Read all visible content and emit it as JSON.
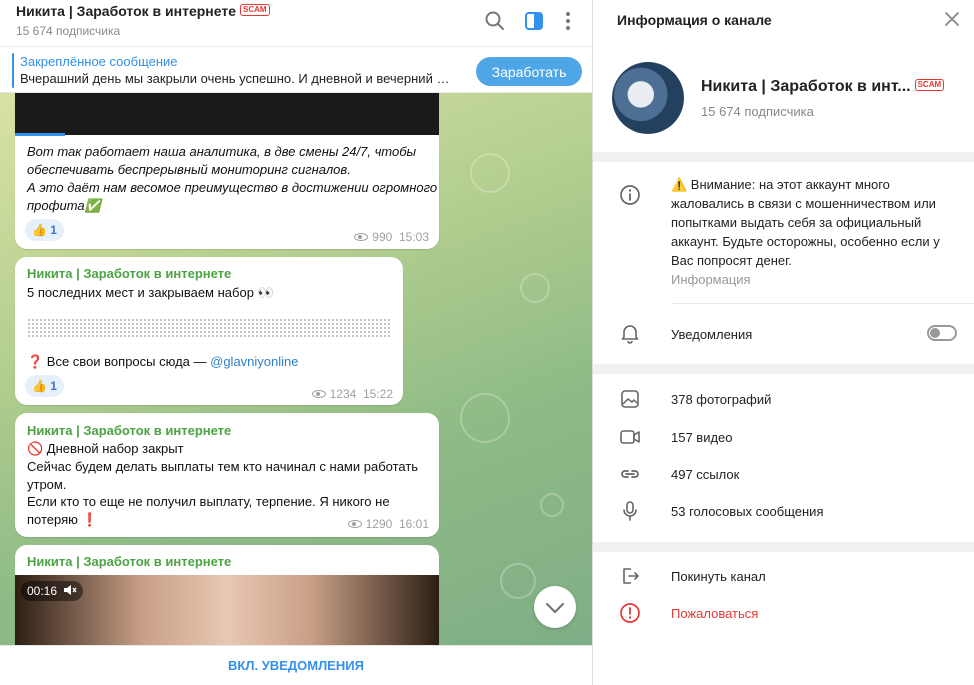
{
  "header": {
    "title": "Никита | Заработок в интернете",
    "scam": "SCAM",
    "subscribers": "15 674 подписчика"
  },
  "pinned": {
    "title": "Закреплённое сообщение",
    "text": "Вчерашний день мы закрыли очень успешно. И дневной и вечерний …",
    "button": "Заработать"
  },
  "messages": [
    {
      "lines": [
        "Вот так работает наша аналитика, в две смены 24/7, чтобы",
        "обеспечивать беспрерывный мониторинг сигналов.",
        "А это даёт нам весомое преимущество в достижении огромного",
        "профита✅"
      ],
      "reaction": "👍 1",
      "views": "990",
      "time": "15:03"
    },
    {
      "sender": "Никита | Заработок в интернете",
      "line1": "5 последних мест и закрываем набор 👀",
      "question": "❓ Все свои вопросы сюда — ",
      "link": "@glavniyonline",
      "reaction": "👍 1",
      "views": "1234",
      "time": "15:22"
    },
    {
      "sender": "Никита | Заработок в интернете",
      "lines": [
        "🚫 Дневной набор закрыт",
        "Сейчас будем делать выплаты тем кто начинал с нами работать",
        "утром.",
        "Если кто то еще не получил выплату, терпение. Я никого не",
        "потеряю ❗"
      ],
      "views": "1290",
      "time": "16:01"
    },
    {
      "sender": "Никита | Заработок в интернете",
      "video_time": "00:16"
    }
  ],
  "bottom": {
    "enable_notifications": "ВКЛ. УВЕДОМЛЕНИЯ"
  },
  "info": {
    "title": "Информация о канале",
    "name": "Никита | Заработок в инт...",
    "scam": "SCAM",
    "subscribers": "15 674 подписчика",
    "about_lines": [
      "⚠️ Внимание: на этот аккаунт много",
      "жаловались в связи с мошенничеством или",
      "попытками выдать себя за официальный",
      "аккаунт. Будьте осторожны, особенно если у",
      "Вас попросят денег."
    ],
    "about_label": "Информация",
    "notifications": "Уведомления",
    "notifications_on": false,
    "photos": "378 фотографий",
    "videos": "157 видео",
    "links": "497 ссылок",
    "voice": "53 голосовых сообщения",
    "leave": "Покинуть канал",
    "report": "Пожаловаться"
  }
}
